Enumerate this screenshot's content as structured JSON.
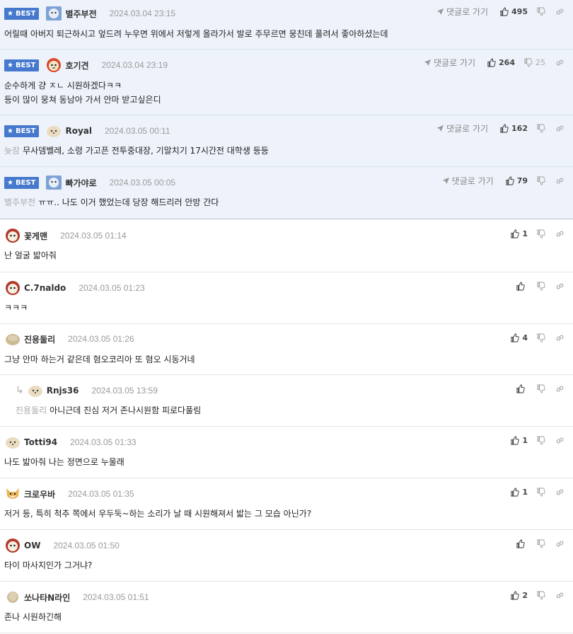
{
  "best_label": "BEST",
  "goto_label": "댓글로 가기",
  "comments": [
    {
      "nick": "별주부전",
      "date": "2024.03.04 23:15",
      "likes": "495",
      "dislikes": "",
      "lines": [
        "어릴때 아버지 퇴근하시고 엎드려 누우면 위에서 저렇게 올라가서 발로 주무르면 뭉친데 풀려서 좋아하셨는데"
      ],
      "tag": ""
    },
    {
      "nick": "호기견",
      "date": "2024.03.04 23:19",
      "likes": "264",
      "dislikes": "25",
      "lines": [
        "순수하게 걍 ㅈㄴ 시원하겠다ㅋㅋ",
        "등이 많이 뭉쳐 동남아 가서 안마 받고싶은디"
      ],
      "tag": ""
    },
    {
      "nick": "Royal",
      "date": "2024.03.05 00:11",
      "likes": "162",
      "dislikes": "",
      "lines": [
        "무사뎀벨레, 소령 가고픈 전투중대장, 기말치기 17시간전 대학생 등등"
      ],
      "tag": "늦잠"
    },
    {
      "nick": "빠가야로",
      "date": "2024.03.05 00:05",
      "likes": "79",
      "dislikes": "",
      "lines": [
        "ㅠㅠ.. 나도 이거 했었는데 당장 해드리러 안방 간다"
      ],
      "tag": "별주부전"
    },
    {
      "nick": "꽃게맨",
      "date": "2024.03.05 01:14",
      "likes": "1",
      "lines": [
        "난 얼굴 밟아줘"
      ],
      "tag": ""
    },
    {
      "nick": "C.7naldo",
      "date": "2024.03.05 01:23",
      "likes": "",
      "lines": [
        "ㅋㅋㅋ"
      ],
      "tag": ""
    },
    {
      "nick": "진용둘리",
      "date": "2024.03.05 01:26",
      "likes": "4",
      "lines": [
        "그냥 안마 하는거 같은데 혐오코리아 또 혐오 시동거네"
      ],
      "tag": ""
    },
    {
      "nick": "Rnjs36",
      "date": "2024.03.05 13:59",
      "likes": "",
      "lines": [
        "아니근데 진심 저거 존나시원함 피로다풀림"
      ],
      "tag": "진용둘리"
    },
    {
      "nick": "Totti94",
      "date": "2024.03.05 01:33",
      "likes": "1",
      "lines": [
        "나도 밟아줘 나는 정면으로 누울래"
      ],
      "tag": ""
    },
    {
      "nick": "크로우바",
      "date": "2024.03.05 01:35",
      "likes": "1",
      "lines": [
        "저거 등, 특히 척추 쪽에서 우두둑~하는 소리가 날 때 시원해져서 밟는 그 모습 아닌가?"
      ],
      "tag": ""
    },
    {
      "nick": "OW",
      "date": "2024.03.05 01:50",
      "likes": "",
      "lines": [
        "타이 마사지인가 그거냐?"
      ],
      "tag": ""
    },
    {
      "nick": "쏘나타N라인",
      "date": "2024.03.05 01:51",
      "likes": "2",
      "lines": [
        "존나 시원하긴해"
      ],
      "tag": ""
    }
  ],
  "colors": {
    "best_badge": "#4679ce",
    "best_bg": "#eef3fb",
    "tag_text": "#a9a9a9"
  }
}
